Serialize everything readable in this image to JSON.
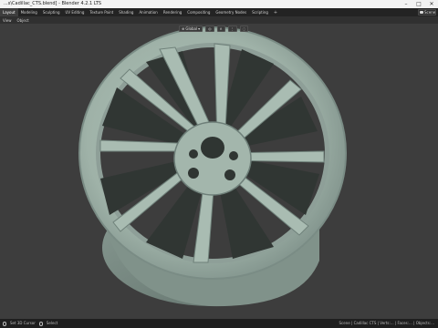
{
  "window": {
    "title": "...s\\Cadillac_CTS.blend] - Blender 4.2.1 LTS",
    "controls": [
      "–",
      "□",
      "✕"
    ]
  },
  "workspace_tabs": [
    {
      "label": "Layout",
      "active": true
    },
    {
      "label": "Modeling",
      "active": false
    },
    {
      "label": "Sculpting",
      "active": false
    },
    {
      "label": "UV Editing",
      "active": false
    },
    {
      "label": "Texture Paint",
      "active": false
    },
    {
      "label": "Shading",
      "active": false
    },
    {
      "label": "Animation",
      "active": false
    },
    {
      "label": "Rendering",
      "active": false
    },
    {
      "label": "Compositing",
      "active": false
    },
    {
      "label": "Geometry Nodes",
      "active": false
    },
    {
      "label": "Scripting",
      "active": false
    }
  ],
  "tab_add": "+",
  "scene": {
    "label": "Scene"
  },
  "viewport_menu": [
    "View",
    "Object"
  ],
  "transform_orientation": {
    "label": "Global"
  },
  "statusbar": {
    "left_items": [
      "Set 3D Cursor",
      "Select"
    ],
    "right_text": "Scene | Cadillac CTS | Verts:... | Faces:... | Objects:..."
  },
  "colors": {
    "viewport_bg": "#3d3d3d",
    "wheel_base": "#9fb2a8",
    "wheel_shadow": "#4e5c56",
    "window_dark": "#232323"
  }
}
